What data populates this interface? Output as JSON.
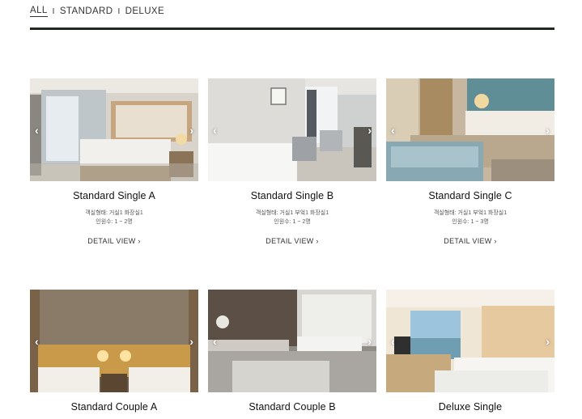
{
  "filters": {
    "all": "ALL",
    "standard": "STANDARD",
    "deluxe": "DELUXE",
    "separator": "I"
  },
  "rooms": [
    {
      "name": "Standard Single A",
      "layout": "객실형태: 거실1 화장실1",
      "capacity": "인원수: 1 ~ 2명",
      "detail": "DETAIL VIEW ›"
    },
    {
      "name": "Standard Single B",
      "layout": "객실형태: 거실1 부엌1 화장실1",
      "capacity": "인원수: 1 ~ 2명",
      "detail": "DETAIL VIEW ›"
    },
    {
      "name": "Standard Single C",
      "layout": "객실형태: 거실1 부엌1 화장실1",
      "capacity": "인원수: 1 ~ 3명",
      "detail": "DETAIL VIEW ›"
    },
    {
      "name": "Standard Couple A"
    },
    {
      "name": "Standard Couple B"
    },
    {
      "name": "Deluxe Single"
    }
  ],
  "arrows": {
    "prev": "‹",
    "next": "›"
  },
  "colors": {
    "rule": "#1f2a22",
    "text": "#222222"
  }
}
